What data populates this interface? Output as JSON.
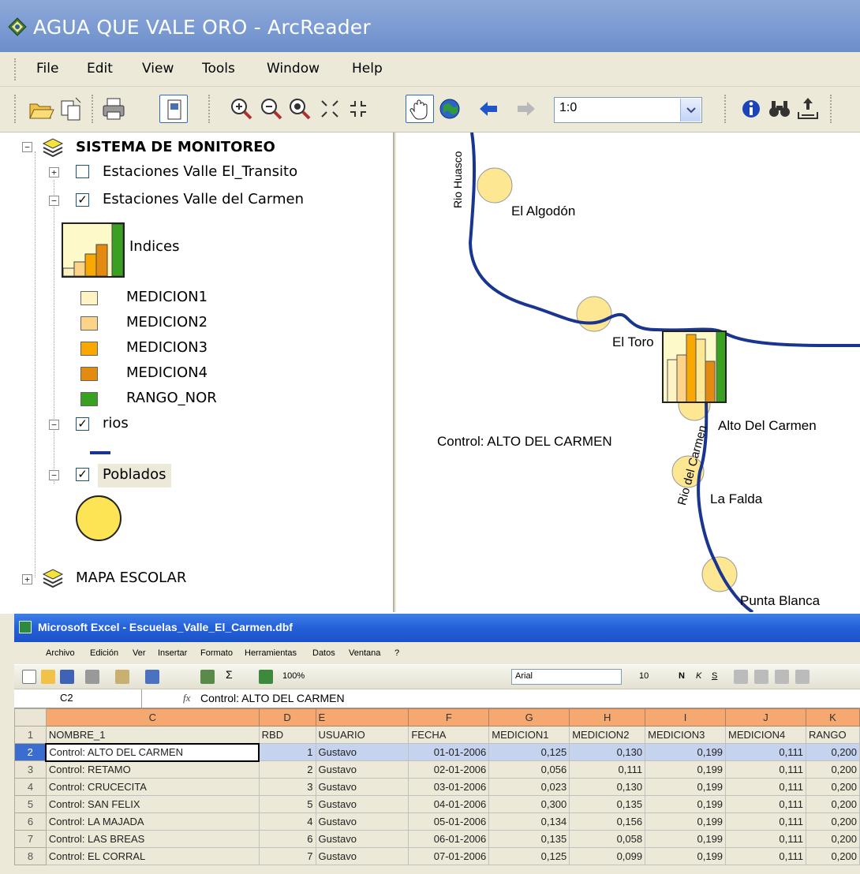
{
  "arcreader": {
    "title": "AGUA QUE VALE ORO - ArcReader",
    "menu": [
      "File",
      "Edit",
      "View",
      "Tools",
      "Window",
      "Help"
    ],
    "toolbar": {
      "icons": [
        "open-icon",
        "copy-icon",
        "print-icon",
        "layout-view-icon",
        "zoom-in-icon",
        "zoom-out-icon",
        "zoom-full-icon",
        "fixed-zoom-in-icon",
        "fixed-zoom-out-icon",
        "pan-icon",
        "globe-icon",
        "back-arrow-icon",
        "forward-arrow-icon",
        "identify-icon",
        "find-icon",
        "export-icon"
      ],
      "scale_value": "1:0"
    },
    "toc": {
      "root": "SISTEMA DE MONITOREO",
      "layers": [
        {
          "label": "Estaciones Valle El_Transito",
          "checked": false,
          "expanded": false
        },
        {
          "label": "Estaciones Valle del Carmen",
          "checked": true,
          "expanded": true
        },
        {
          "label": "rios",
          "checked": true,
          "expanded": true
        },
        {
          "label": "Poblados",
          "checked": true,
          "expanded": true
        }
      ],
      "legend_title": "Indices",
      "legend": [
        {
          "label": "MEDICION1",
          "color": "#fff3c4"
        },
        {
          "label": "MEDICION2",
          "color": "#fdd38a"
        },
        {
          "label": "MEDICION3",
          "color": "#f8a800"
        },
        {
          "label": "MEDICION4",
          "color": "#e38a10"
        },
        {
          "label": "RANGO_NOR",
          "color": "#3aa022"
        }
      ],
      "second_group": "MAPA ESCOLAR"
    },
    "map": {
      "labels": {
        "rio_huasco": "Rio Huasco",
        "el_algodon": "El Algodón",
        "el_toro": "El Toro",
        "alto_del_carmen": "Alto Del Carmen",
        "control": "Control: ALTO  DEL CARMEN",
        "rio_del_carmen": "Rio del Carmen",
        "la_falda": "La Falda",
        "punta_blanca": "Punta Blanca"
      },
      "river_color": "#1a3590",
      "town_color": "#fde793"
    }
  },
  "excel": {
    "title": "Microsoft Excel - Escuelas_Valle_El_Carmen.dbf",
    "menu": [
      "Archivo",
      "Edición",
      "Ver",
      "Insertar",
      "Formato",
      "Herramientas",
      "Datos",
      "Ventana",
      "?"
    ],
    "toolbar": {
      "zoom": "100%",
      "font": "Arial",
      "font_size": "10"
    },
    "name_box": "C2",
    "formula_label": "fx",
    "formula": "Control: ALTO  DEL CARMEN",
    "columns": [
      "C",
      "D",
      "E",
      "F",
      "G",
      "H",
      "I",
      "J",
      "K"
    ],
    "header_row": [
      "NOMBRE_1",
      "RBD",
      "USUARIO",
      "FECHA",
      "MEDICION1",
      "MEDICION2",
      "MEDICION3",
      "MEDICION4",
      "RANGO"
    ],
    "rows": [
      {
        "n": "2",
        "cells": [
          "Control: ALTO  DEL CARMEN",
          "1",
          "Gustavo",
          "01-01-2006",
          "0,125",
          "0,130",
          "0,199",
          "0,111",
          "0,200"
        ]
      },
      {
        "n": "3",
        "cells": [
          "Control: RETAMO",
          "2",
          "Gustavo",
          "02-01-2006",
          "0,056",
          "0,111",
          "0,199",
          "0,111",
          "0,200"
        ]
      },
      {
        "n": "4",
        "cells": [
          "Control: CRUCECITA",
          "3",
          "Gustavo",
          "03-01-2006",
          "0,023",
          "0,130",
          "0,199",
          "0,111",
          "0,200"
        ]
      },
      {
        "n": "5",
        "cells": [
          "Control: SAN FELIX",
          "5",
          "Gustavo",
          "04-01-2006",
          "0,300",
          "0,135",
          "0,199",
          "0,111",
          "0,200"
        ]
      },
      {
        "n": "6",
        "cells": [
          "Control: LA  MAJADA",
          "4",
          "Gustavo",
          "05-01-2006",
          "0,134",
          "0,156",
          "0,199",
          "0,111",
          "0,200"
        ]
      },
      {
        "n": "7",
        "cells": [
          "Control: LAS  BREAS",
          "6",
          "Gustavo",
          "06-01-2006",
          "0,135",
          "0,058",
          "0,199",
          "0,111",
          "0,200"
        ]
      },
      {
        "n": "8",
        "cells": [
          "Control: EL  CORRAL",
          "7",
          "Gustavo",
          "07-01-2006",
          "0,125",
          "0,099",
          "0,199",
          "0,111",
          "0,200"
        ]
      }
    ]
  }
}
